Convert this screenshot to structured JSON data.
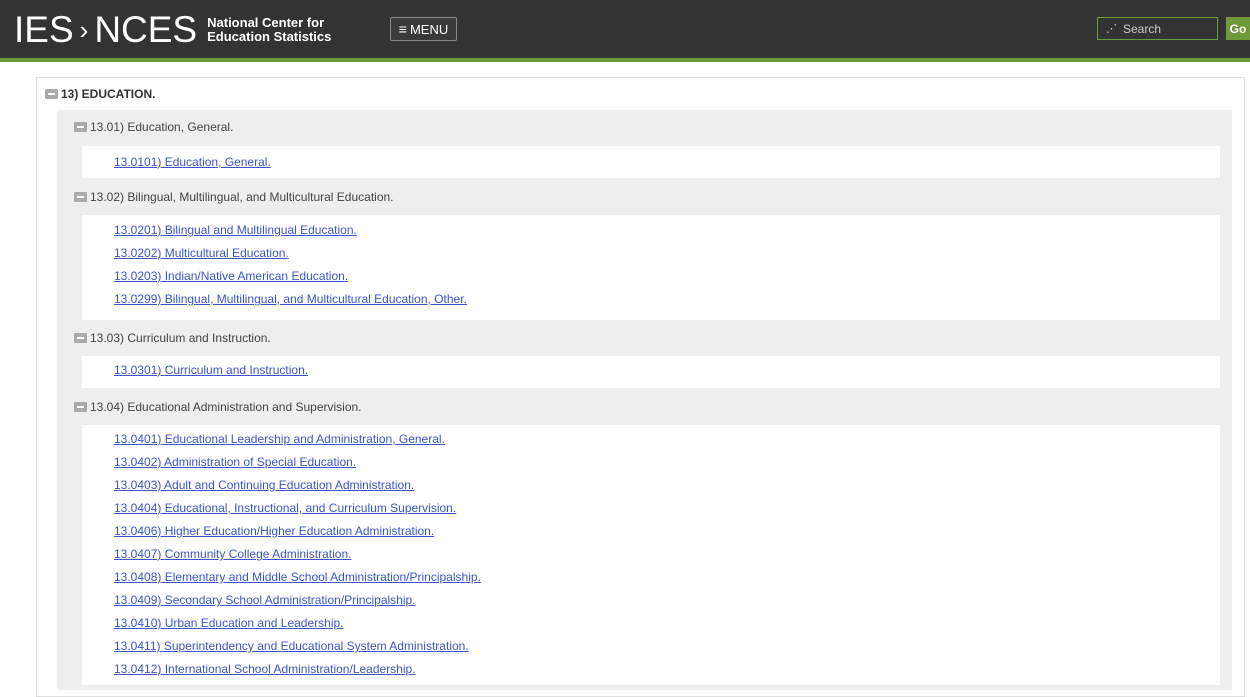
{
  "header": {
    "logo_ies": "IES",
    "logo_chevron": "›",
    "logo_nces": "NCES",
    "tagline_line1": "National Center for",
    "tagline_line2": "Education Statistics",
    "menu_icon": "≡",
    "menu_label": "MENU",
    "search_placeholder": "Search",
    "go_label": "Go"
  },
  "content": {
    "root_label": "13) EDUCATION.",
    "groups": [
      {
        "label": "13.01) Education, General.",
        "links": [
          "13.0101) Education, General."
        ]
      },
      {
        "label": "13.02) Bilingual, Multilingual, and Multicultural Education.",
        "links": [
          "13.0201) Bilingual and Multilingual Education.",
          "13.0202) Multicultural Education.",
          "13.0203) Indian/Native American Education.",
          "13.0299) Bilingual, Multilingual, and Multicultural Education, Other."
        ]
      },
      {
        "label": "13.03) Curriculum and Instruction.",
        "links": [
          "13.0301) Curriculum and Instruction."
        ]
      },
      {
        "label": "13.04) Educational Administration and Supervision.",
        "links": [
          "13.0401) Educational Leadership and Administration, General.",
          "13.0402) Administration of Special Education.",
          "13.0403) Adult and Continuing Education Administration.",
          "13.0404) Educational, Instructional, and Curriculum Supervision.",
          "13.0406) Higher Education/Higher Education Administration.",
          "13.0407) Community College Administration.",
          "13.0408) Elementary and Middle School Administration/Principalship.",
          "13.0409) Secondary School Administration/Principalship.",
          "13.0410) Urban Education and Leadership.",
          "13.0411) Superintendency and Educational System Administration.",
          "13.0412) International School Administration/Leadership."
        ]
      }
    ]
  }
}
